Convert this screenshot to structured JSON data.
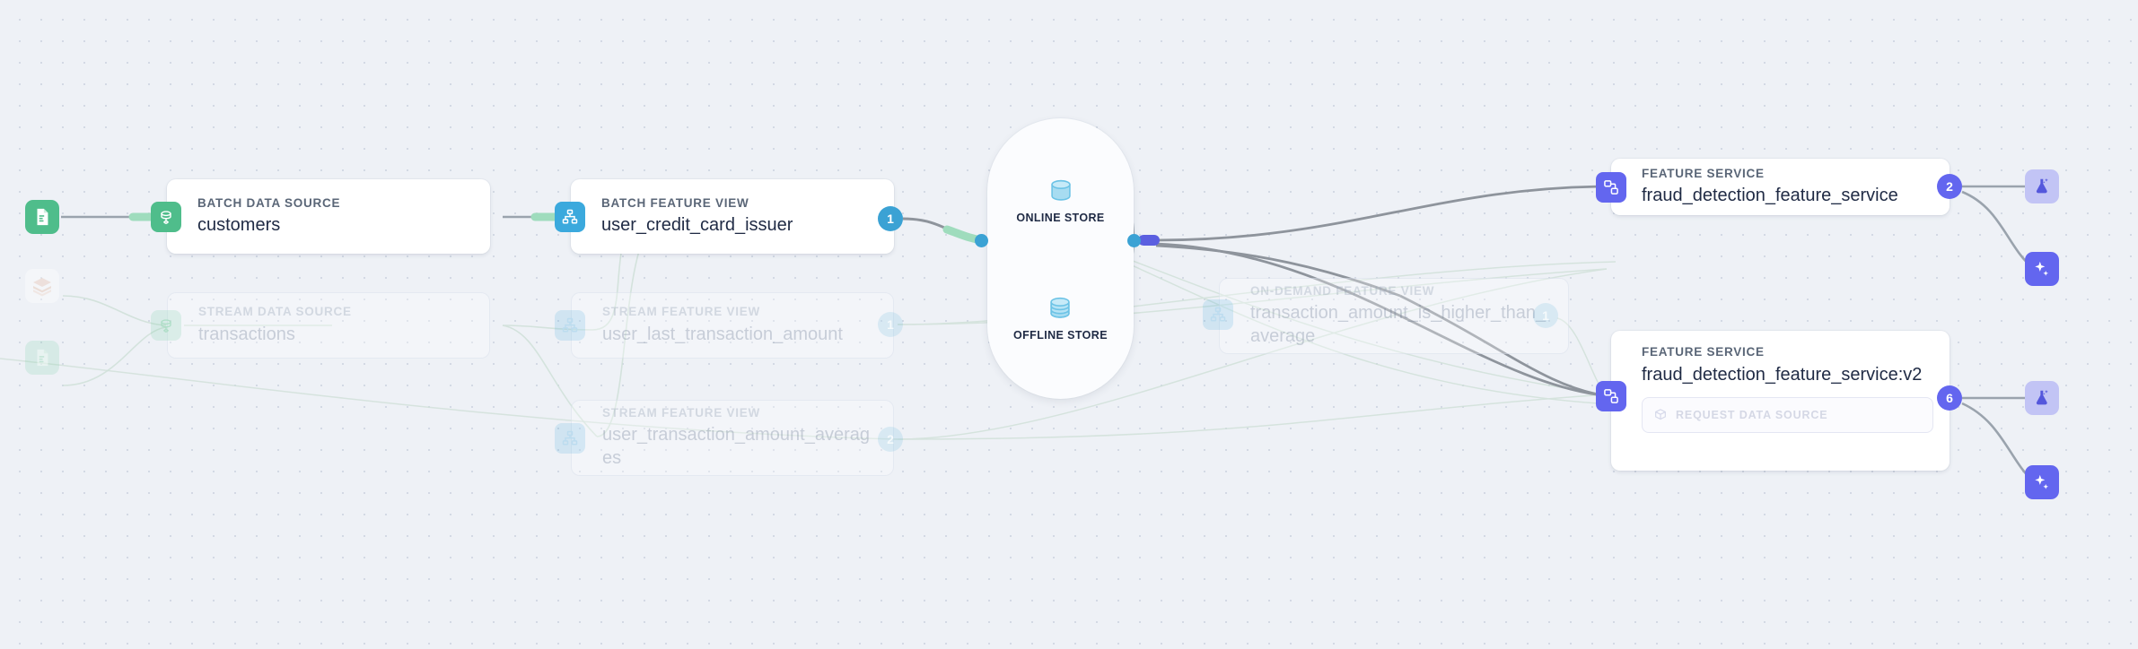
{
  "canvas": {
    "background_color": "#eef1f6",
    "dot_color": "#d3d9e4"
  },
  "colors": {
    "batch_source_accent": "#4fbd8b",
    "feature_view_accent": "#3ba9dd",
    "feature_service_accent": "#6366ef",
    "badge_blue": "#3ba2d4",
    "badge_purple": "#6366ef",
    "store_port": "#3ba2d4",
    "store_port_bar": "#5b5fe0"
  },
  "sources": [
    {
      "id": "file-source-active",
      "icon": "file-document-icon",
      "state": "active"
    },
    {
      "id": "databricks-source-faded",
      "icon": "databricks-icon",
      "state": "faded"
    },
    {
      "id": "file-source-faded",
      "icon": "file-document-icon",
      "state": "faded"
    }
  ],
  "nodes": [
    {
      "id": "batch-data-source-customers",
      "kind": "BATCH DATA SOURCE",
      "title": "customers",
      "icon": "database-source-icon",
      "state": "active",
      "badge": null
    },
    {
      "id": "stream-data-source-transactions",
      "kind": "STREAM DATA SOURCE",
      "title": "transactions",
      "icon": "database-source-icon",
      "state": "faded",
      "badge": null
    },
    {
      "id": "batch-feature-view-user-credit-card-issuer",
      "kind": "BATCH FEATURE VIEW",
      "title": "user_credit_card_issuer",
      "icon": "feature-view-icon",
      "state": "active",
      "badge": "1"
    },
    {
      "id": "stream-feature-view-user-last-transaction-amount",
      "kind": "STREAM FEATURE VIEW",
      "title": "user_last_transaction_amount",
      "icon": "feature-view-icon",
      "state": "faded",
      "badge": "1"
    },
    {
      "id": "stream-feature-view-user-transaction-amount-averages",
      "kind": "STREAM FEATURE VIEW",
      "title": "user_transaction_amount_averages",
      "icon": "feature-view-icon",
      "state": "faded",
      "badge": "2"
    },
    {
      "id": "on-demand-feature-view-transaction-amount-is-higher-than-average",
      "kind": "ON-DEMAND FEATURE VIEW",
      "title": "transaction_amount_is_higher_than_average",
      "icon": "feature-view-icon",
      "state": "faded",
      "badge": "1"
    },
    {
      "id": "feature-service-fraud-detection",
      "kind": "FEATURE SERVICE",
      "title": "fraud_detection_feature_service",
      "icon": "feature-service-icon",
      "state": "active",
      "badge": "2"
    },
    {
      "id": "feature-service-fraud-detection-v2",
      "kind": "FEATURE SERVICE",
      "title": "fraud_detection_feature_service:v2",
      "icon": "feature-service-icon",
      "state": "active",
      "badge": "6",
      "request_data_source": {
        "label": "REQUEST DATA SOURCE",
        "icon": "cube-request-icon"
      }
    }
  ],
  "store": {
    "online": {
      "label": "ONLINE STORE",
      "icon": "database-cylinder-icon"
    },
    "offline": {
      "label": "OFFLINE STORE",
      "icon": "database-stacked-cylinder-icon"
    }
  },
  "consumers": [
    {
      "id": "consumer-flask-1",
      "icon": "flask-sparkle-icon",
      "state": "muted"
    },
    {
      "id": "consumer-sparkle-1",
      "icon": "sparkle-icon",
      "state": "active"
    },
    {
      "id": "consumer-flask-2",
      "icon": "flask-sparkle-icon",
      "state": "muted"
    },
    {
      "id": "consumer-sparkle-2",
      "icon": "sparkle-icon",
      "state": "active"
    }
  ]
}
